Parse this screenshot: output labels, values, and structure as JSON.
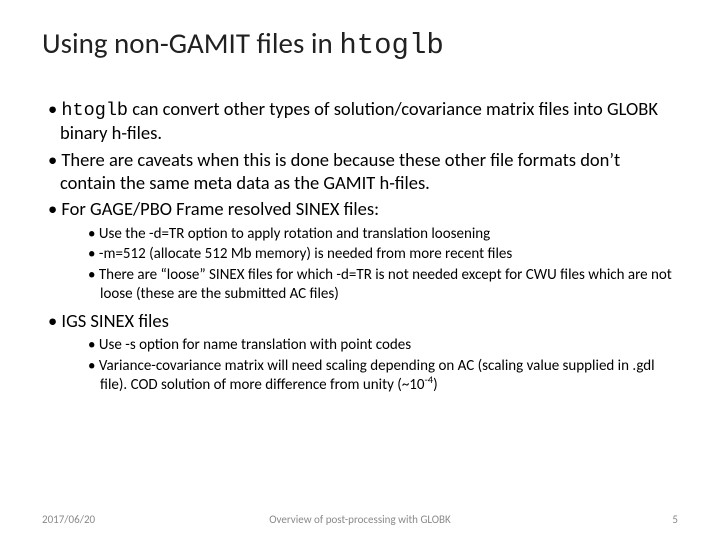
{
  "title_prefix": "Using non-GAMIT files in ",
  "title_code": "htoglb",
  "bullets": {
    "b1_code": "htoglb",
    "b1_rest": " can convert other types of solution/covariance matrix files into GLOBK binary h-files.",
    "b2": "There are caveats when this is done because these other file formats don’t contain the same meta data as the GAMIT h-files.",
    "b3": "For GAGE/PBO Frame resolved SINEX files:",
    "b3a": "Use the -d=TR option to apply rotation and translation loosening",
    "b3b": "-m=512 (allocate 512 Mb memory) is needed from more recent files",
    "b3c": "There are “loose” SINEX files for which -d=TR is not needed except for CWU files which are not loose (these are the submitted AC files)",
    "b4": "IGS SINEX files",
    "b4a": "Use -s option for name translation with point codes",
    "b4b_pre": "Variance-covariance matrix will need scaling depending on AC (scaling value supplied in .gdl file).  COD solution of more difference from unity (~10",
    "b4b_sup": "-4",
    "b4b_post": ")"
  },
  "footer": {
    "date": "2017/06/20",
    "center": "Overview of post-processing with GLOBK",
    "page": "5"
  }
}
